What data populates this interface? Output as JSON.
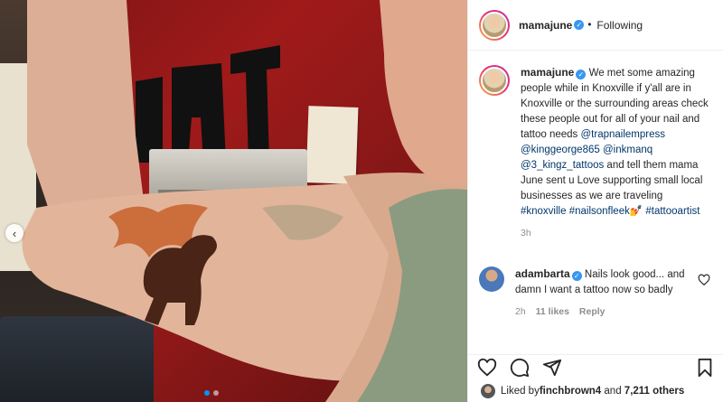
{
  "post": {
    "username": "mamajune",
    "follow_status": "Following",
    "separator": "•"
  },
  "caption": {
    "author": "mamajune",
    "text_1": "We met some amazing people while in Knoxville if y'all are in Knoxville or the surrounding areas check these people out for all of your nail and tattoo needs ",
    "mention_1": "@trapnailempress",
    "mention_2": "@kinggeorge865",
    "mention_3": "@inkmanq",
    "mention_4": "@3_kingz_tattoos",
    "text_2": " and tell them mama June sent u Love supporting small local businesses as we are traveling ",
    "hashtag_1": "#knoxville",
    "hashtag_2": "#nailsonfleek",
    "emoji": "💅",
    "hashtag_3": "#tattooartist",
    "time": "3h"
  },
  "comment": {
    "author": "adambarta",
    "text": "Nails look good... and damn I want a tattoo now so badly",
    "time": "2h",
    "likes": "11 likes",
    "reply": "Reply"
  },
  "likes_line": {
    "prefix": "Liked by ",
    "user": "finchbrown4",
    "middle": " and ",
    "count": "7,211 others"
  },
  "icons": {
    "like": "heart-icon",
    "comment": "comment-icon",
    "share": "share-icon",
    "save": "bookmark-icon",
    "prev": "chevron-left-icon",
    "comment_like": "heart-icon"
  },
  "colors": {
    "accent": "#0095f6",
    "verified": "#3897f0",
    "link": "#00376b",
    "muted": "#8e8e8e"
  },
  "carousel": {
    "dot_count": 2,
    "active_index": 0
  }
}
